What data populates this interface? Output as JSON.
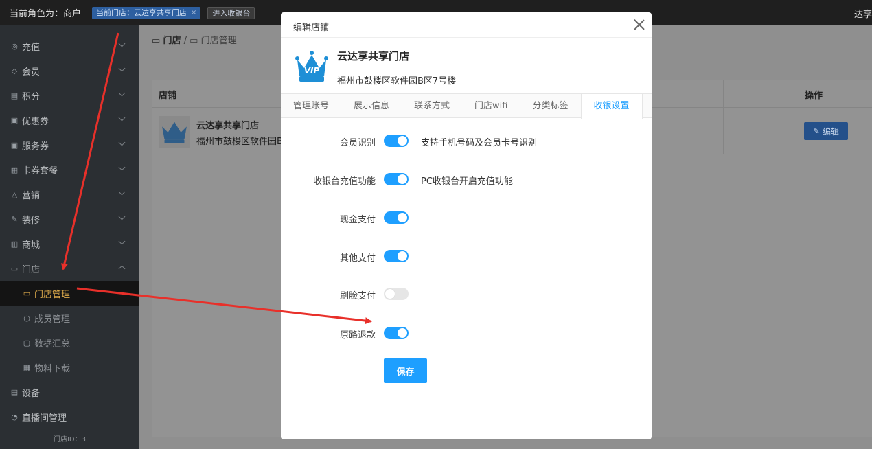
{
  "topbar": {
    "role": "当前角色为：商户",
    "store_tag": "当前门店：云达享共享门店",
    "store_tag_close": "×",
    "cashier": "进入收银台",
    "right_user": "达享"
  },
  "sidebar": {
    "items": [
      {
        "label": "充值",
        "icon": "recharge-icon"
      },
      {
        "label": "会员",
        "icon": "member-icon"
      },
      {
        "label": "积分",
        "icon": "points-icon"
      },
      {
        "label": "优惠券",
        "icon": "coupon-icon"
      },
      {
        "label": "服务券",
        "icon": "service-voucher-icon"
      },
      {
        "label": "卡券套餐",
        "icon": "card-package-icon"
      },
      {
        "label": "营销",
        "icon": "marketing-icon"
      },
      {
        "label": "装修",
        "icon": "decorate-icon"
      },
      {
        "label": "商城",
        "icon": "mall-icon"
      },
      {
        "label": "门店",
        "icon": "store-icon"
      }
    ],
    "sub_items": [
      {
        "label": "门店管理",
        "icon": "store-manage-icon"
      },
      {
        "label": "成员管理",
        "icon": "user-icon"
      },
      {
        "label": "数据汇总",
        "icon": "data-icon"
      },
      {
        "label": "物料下载",
        "icon": "download-icon"
      }
    ],
    "bottom_items": [
      {
        "label": "设备",
        "icon": "printer-icon"
      },
      {
        "label": "直播间管理",
        "icon": "live-icon"
      }
    ],
    "footer": "门店ID：3"
  },
  "main": {
    "breadcrumb_root": "门店",
    "breadcrumb_sep": "/",
    "breadcrumb_current": "门店管理",
    "table": {
      "col_store": "店铺",
      "col_action": "操作",
      "row": {
        "name": "云达享共享门店",
        "address": "福州市鼓楼区软件园B"
      },
      "edit_label": "编辑"
    }
  },
  "modal": {
    "title": "编辑店铺",
    "store_name": "云达享共享门店",
    "store_address": "福州市鼓楼区软件园B区7号楼",
    "logo_text": "VIP",
    "tabs": [
      "管理账号",
      "展示信息",
      "联系方式",
      "门店wifi",
      "分类标签",
      "收银设置"
    ],
    "active_tab": 5,
    "settings": [
      {
        "label": "会员识别",
        "on": true,
        "hint": "支持手机号码及会员卡号识别"
      },
      {
        "label": "收银台充值功能",
        "on": true,
        "hint": "PC收银台开启充值功能"
      },
      {
        "label": "现金支付",
        "on": true,
        "hint": ""
      },
      {
        "label": "其他支付",
        "on": true,
        "hint": ""
      },
      {
        "label": "刷脸支付",
        "on": false,
        "hint": ""
      },
      {
        "label": "原路退款",
        "on": true,
        "hint": ""
      }
    ],
    "save_label": "保存"
  },
  "colors": {
    "accent": "#1e9fff",
    "active_menu": "#d9a74a",
    "annotation_arrow": "#e8302a"
  }
}
